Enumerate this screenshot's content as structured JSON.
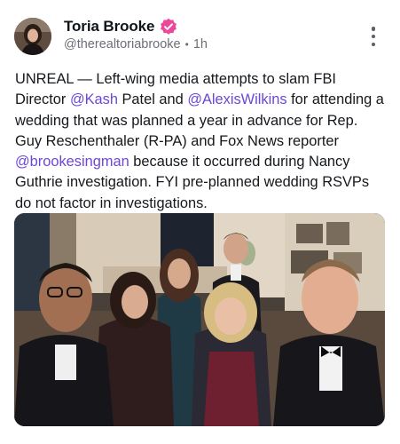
{
  "post": {
    "author": {
      "display_name": "Toria Brooke",
      "handle": "@therealtoriabrooke",
      "time": "1h",
      "separator": "•",
      "verified_color": "#ec4899"
    },
    "text": {
      "part1": "UNREAL — Left-wing media attempts to slam FBI Director ",
      "mention1": "@Kash",
      "part2": " Patel and ",
      "mention2": "@AlexisWilkins",
      "part3": " for attending a wedding that was planned a year in advance for Rep. Guy Reschenthaler (R-PA) and Fox News reporter ",
      "mention3": "@brookesingman",
      "part4": " because it occurred during Nancy Guthrie investigation. FYI pre-planned wedding RSVPs do not factor in investigations."
    },
    "mention_color": "#6c47d8"
  }
}
